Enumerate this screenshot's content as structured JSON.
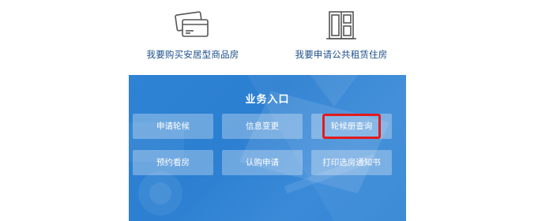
{
  "top_links": {
    "buy": {
      "label": "我要购买安居型商品房",
      "icon": "credit-card-icon"
    },
    "rent": {
      "label": "我要申请公共租赁住房",
      "icon": "window-building-icon"
    }
  },
  "business_panel": {
    "title": "业务入口",
    "buttons": [
      "申请轮候",
      "信息变更",
      "轮候册查询",
      "预约看房",
      "认购申请",
      "打印选房通知书"
    ],
    "highlighted_button": "轮候册查询"
  },
  "colors": {
    "panel_blue": "#2e83d4",
    "link_text": "#1c4f8a",
    "highlight_red": "#e21b1b"
  }
}
